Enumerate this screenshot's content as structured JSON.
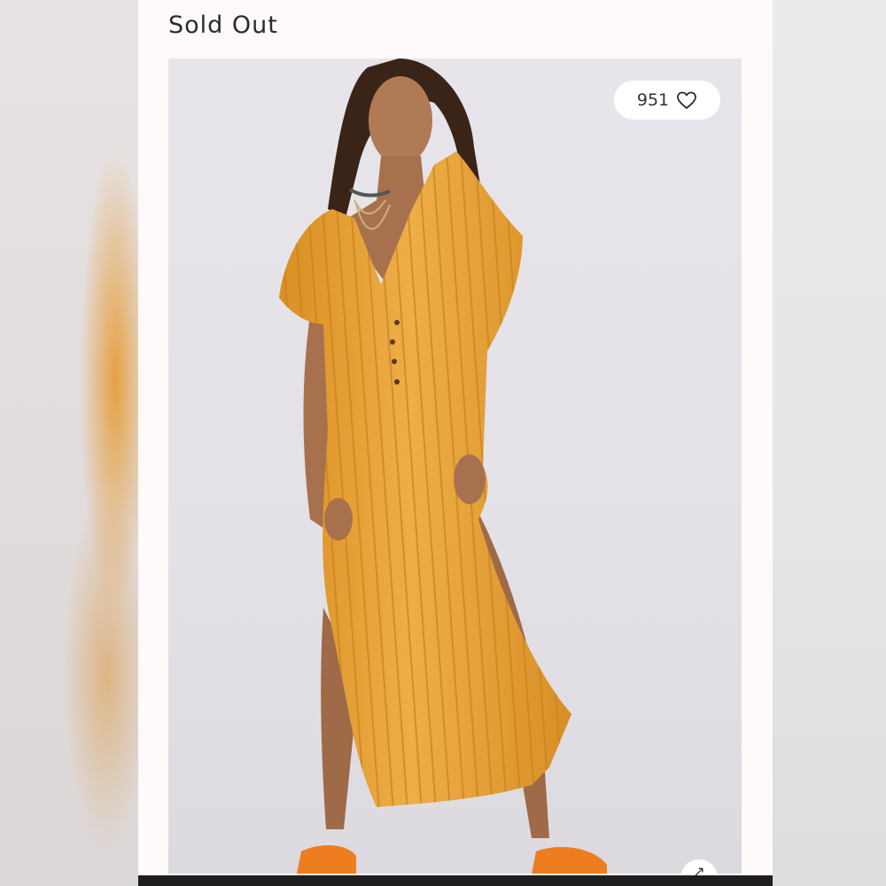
{
  "status": {
    "label": "Sold Out"
  },
  "product_image": {
    "description_alt": "",
    "likes": {
      "count": "951",
      "icon": "heart-outline-icon"
    }
  },
  "corner_button": {
    "icon": "expand-arrow-icon"
  },
  "colors": {
    "dress": "#e9a53b",
    "background": "#e6e4e9",
    "card": "#fdfaf9"
  }
}
